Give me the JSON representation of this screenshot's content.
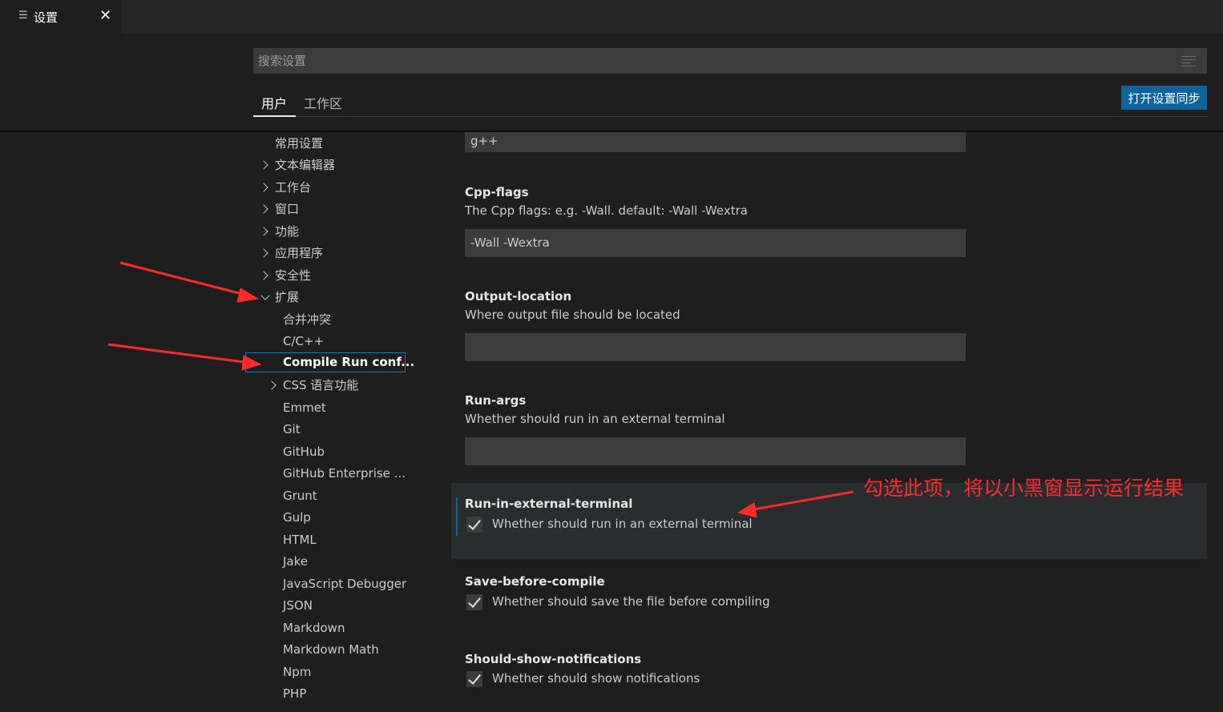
{
  "tab": {
    "icon": "settings-list-icon",
    "title": "设置",
    "close": "✕"
  },
  "search": {
    "placeholder": "搜索设置",
    "value": ""
  },
  "scope_tabs": {
    "user": "用户",
    "workspace": "工作区"
  },
  "sync_button": "打开设置同步",
  "toc": {
    "common": "常用设置",
    "text_editor": "文本编辑器",
    "workbench": "工作台",
    "window": "窗口",
    "features": "功能",
    "application": "应用程序",
    "security": "安全性",
    "extensions": "扩展",
    "merge_conflict": "合并冲突",
    "cpp": "C/C++",
    "compile_run": "Compile Run conf...",
    "css": "CSS 语言功能",
    "emmet": "Emmet",
    "git": "Git",
    "github": "GitHub",
    "github_enterprise": "GitHub Enterprise ...",
    "grunt": "Grunt",
    "gulp": "Gulp",
    "html": "HTML",
    "jake": "Jake",
    "js_debugger": "JavaScript Debugger",
    "json": "JSON",
    "markdown": "Markdown",
    "markdown_math": "Markdown Math",
    "npm": "Npm",
    "php": "PHP"
  },
  "settings": {
    "compiler_value": "g++",
    "cpp_flags": {
      "title": "Cpp-flags",
      "desc": "The Cpp flags: e.g. -Wall. default: -Wall -Wextra",
      "value": "-Wall -Wextra"
    },
    "output_location": {
      "title": "Output-location",
      "desc": "Where output file should be located",
      "value": ""
    },
    "run_args": {
      "title": "Run-args",
      "desc": "Whether should run in an external terminal",
      "value": ""
    },
    "run_in_external_terminal": {
      "title": "Run-in-external-terminal",
      "desc": "Whether should run in an external terminal",
      "checked": true
    },
    "save_before_compile": {
      "title": "Save-before-compile",
      "desc": "Whether should save the file before compiling",
      "checked": true
    },
    "should_show_notifications": {
      "title": "Should-show-notifications",
      "desc": "Whether should show notifications",
      "checked": true
    }
  },
  "annotation": {
    "text": "勾选此项，将以小黑窗显示运行结果",
    "color": "#ff2b2b"
  },
  "colors": {
    "accent": "#0e639c",
    "focus_border": "#007fd4",
    "background": "#1e1e1e"
  }
}
